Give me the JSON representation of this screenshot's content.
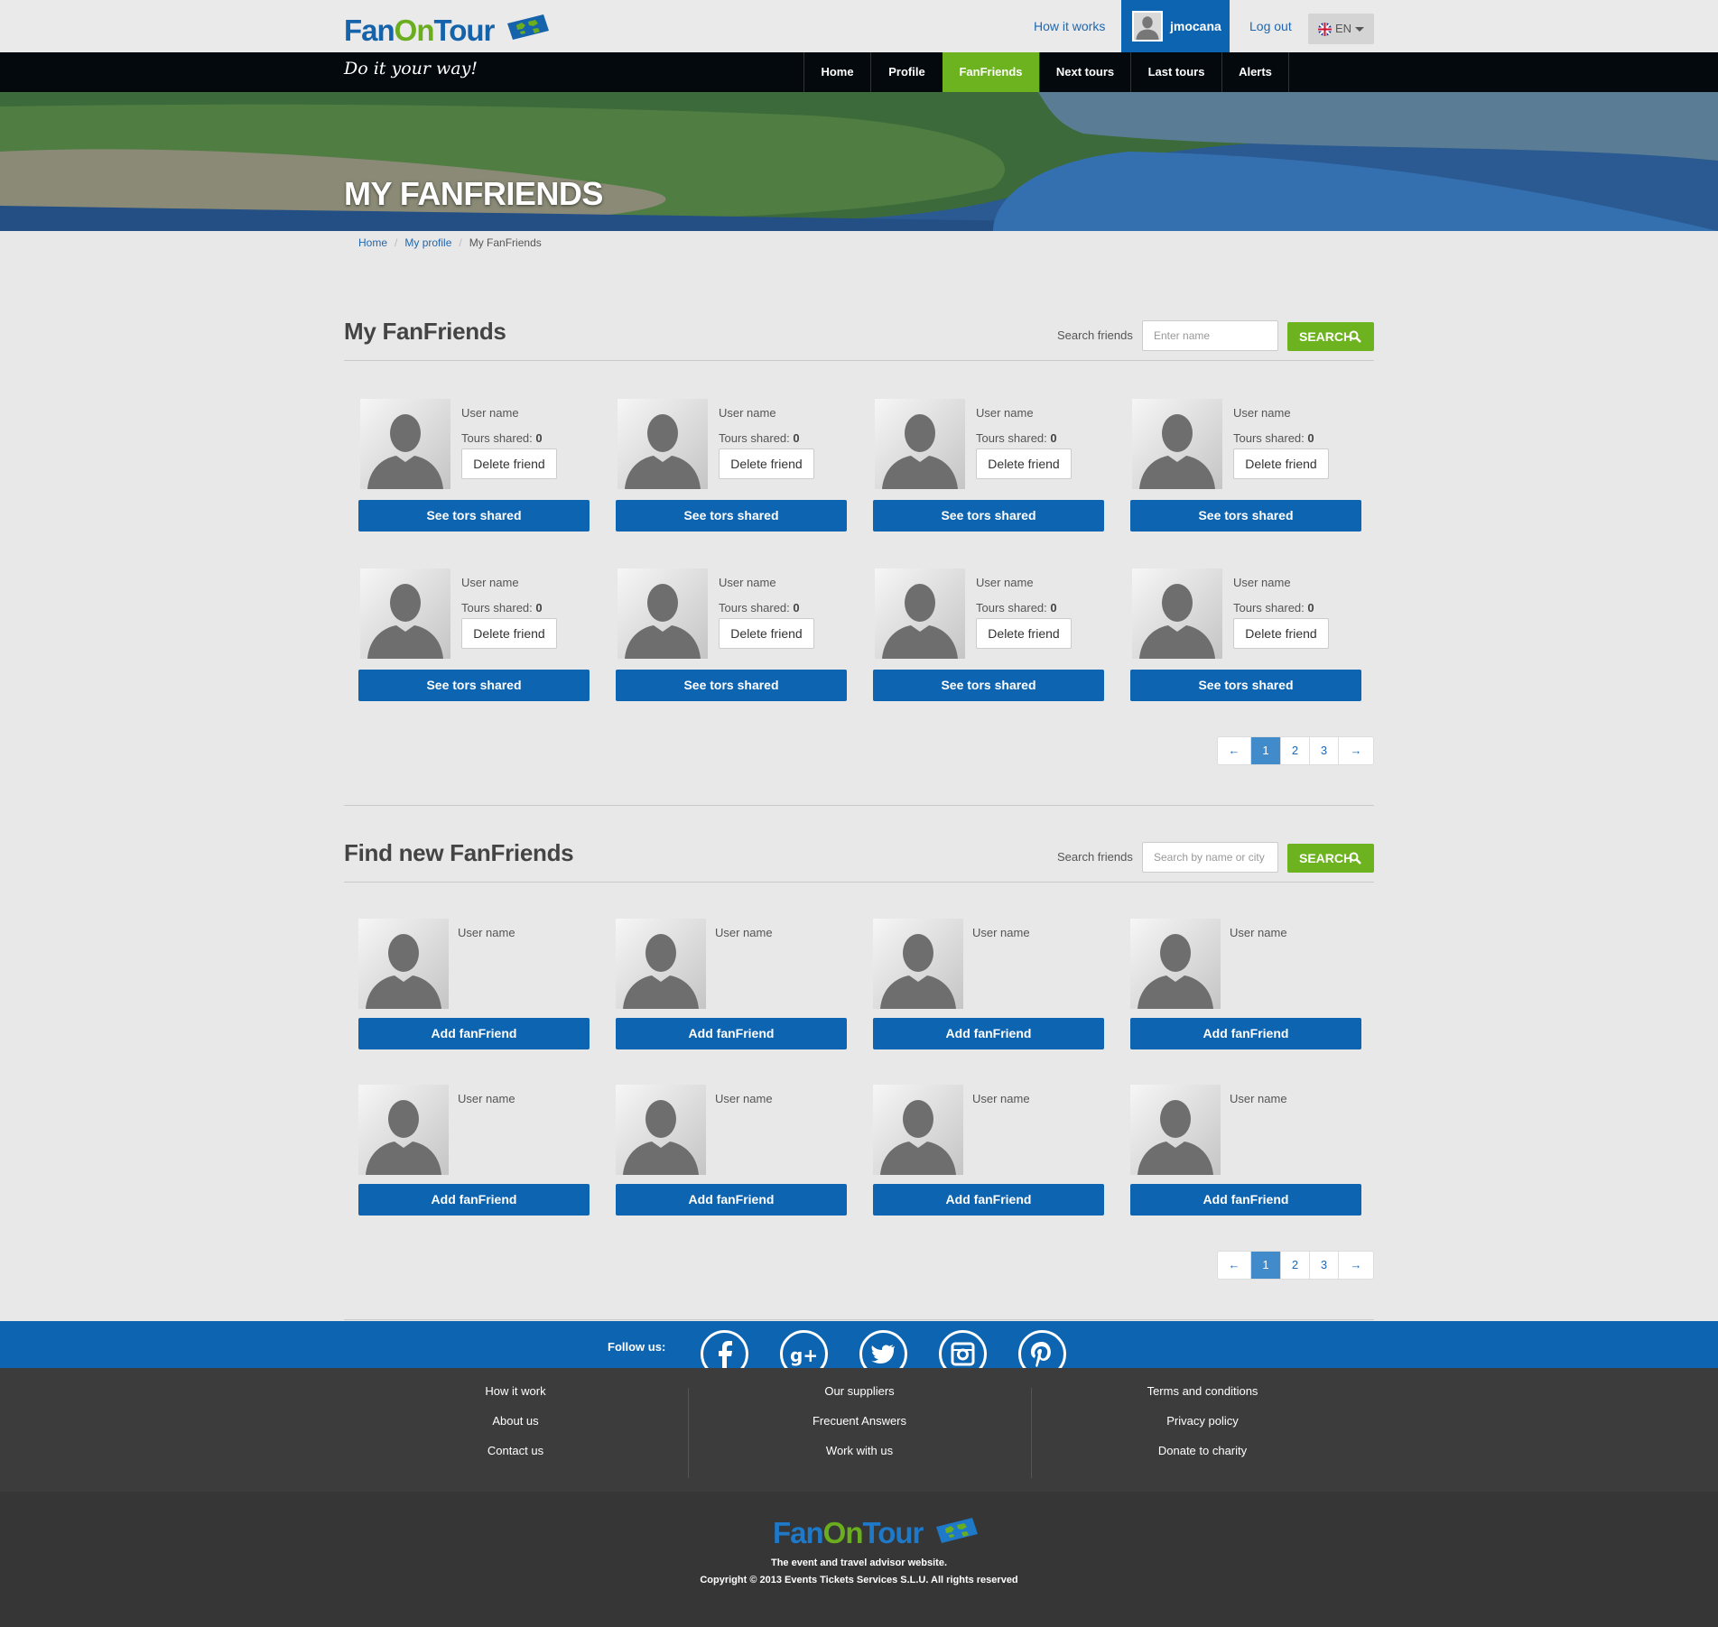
{
  "brand": {
    "fan": "Fan",
    "on": "On",
    "tour": "Tour",
    "slogan": "Do it your way!"
  },
  "top": {
    "how_it_works": "How it works",
    "username": "jmocana",
    "logout": "Log out",
    "lang": "EN"
  },
  "nav": [
    "Home",
    "Profile",
    "FanFriends",
    "Next tours",
    "Last tours",
    "Alerts"
  ],
  "hero_title": "MY FANFRIENDS",
  "breadcrumb": [
    "Home",
    "My profile",
    "My FanFriends"
  ],
  "my_friends": {
    "title": "My FanFriends",
    "search_label": "Search friends",
    "search_placeholder": "Enter name",
    "search_button": "SEARCH",
    "cards": [
      {
        "name": "User name",
        "shared_label": "Tours shared:",
        "shared": "0",
        "delete": "Delete friend",
        "action": "See tors shared"
      },
      {
        "name": "User name",
        "shared_label": "Tours shared:",
        "shared": "0",
        "delete": "Delete friend",
        "action": "See tors shared"
      },
      {
        "name": "User name",
        "shared_label": "Tours shared:",
        "shared": "0",
        "delete": "Delete friend",
        "action": "See tors shared"
      },
      {
        "name": "User name",
        "shared_label": "Tours shared:",
        "shared": "0",
        "delete": "Delete friend",
        "action": "See tors shared"
      },
      {
        "name": "User name",
        "shared_label": "Tours shared:",
        "shared": "0",
        "delete": "Delete friend",
        "action": "See tors shared"
      },
      {
        "name": "User name",
        "shared_label": "Tours shared:",
        "shared": "0",
        "delete": "Delete friend",
        "action": "See tors shared"
      },
      {
        "name": "User name",
        "shared_label": "Tours shared:",
        "shared": "0",
        "delete": "Delete friend",
        "action": "See tors shared"
      },
      {
        "name": "User name",
        "shared_label": "Tours shared:",
        "shared": "0",
        "delete": "Delete friend",
        "action": "See tors shared"
      }
    ],
    "pager": [
      "←",
      "1",
      "2",
      "3",
      "→"
    ]
  },
  "find_friends": {
    "title": "Find new FanFriends",
    "search_label": "Search friends",
    "search_placeholder": "Search by name or city",
    "search_button": "SEARCH",
    "cards": [
      {
        "name": "User name",
        "action": "Add fanFriend"
      },
      {
        "name": "User name",
        "action": "Add fanFriend"
      },
      {
        "name": "User name",
        "action": "Add fanFriend"
      },
      {
        "name": "User name",
        "action": "Add fanFriend"
      },
      {
        "name": "User name",
        "action": "Add fanFriend"
      },
      {
        "name": "User name",
        "action": "Add fanFriend"
      },
      {
        "name": "User name",
        "action": "Add fanFriend"
      },
      {
        "name": "User name",
        "action": "Add fanFriend"
      }
    ],
    "pager": [
      "←",
      "1",
      "2",
      "3",
      "→"
    ]
  },
  "footer": {
    "follow": "Follow us:",
    "social_icons": [
      "facebook-icon",
      "google-plus-icon",
      "twitter-icon",
      "instagram-icon",
      "pinterest-icon"
    ],
    "col1": [
      "How it work",
      "About us",
      "Contact us"
    ],
    "col2": [
      "Our suppliers",
      "Frecuent Answers",
      "Work with us"
    ],
    "col3": [
      "Terms and conditions",
      "Privacy policy",
      "Donate to charity"
    ],
    "tagline": "The event and travel advisor website.",
    "copyright": "Copyright © 2013 Events Tickets Services S.L.U. All rights reserved"
  },
  "colors": {
    "primary_blue": "#0d64b0",
    "accent_green": "#6db31f",
    "page_bg": "#e8e8e8",
    "footer_dark": "#3c3c3c"
  }
}
